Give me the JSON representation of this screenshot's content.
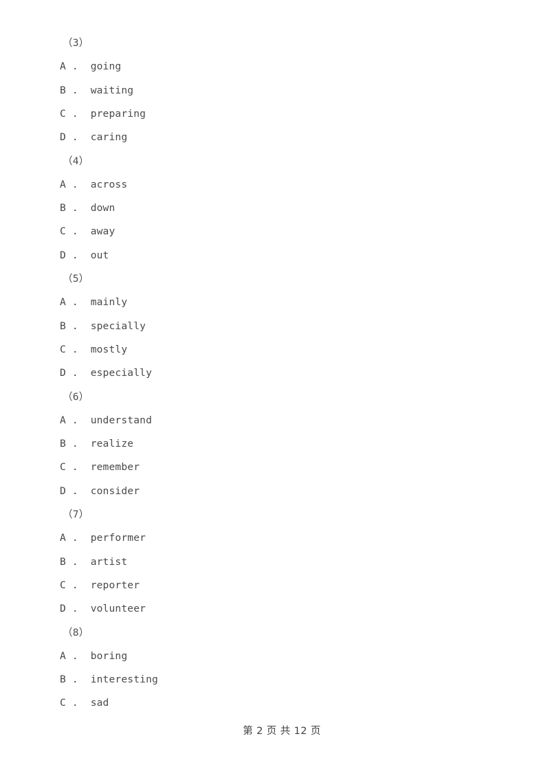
{
  "document": {
    "type": "exam-paper-page",
    "background_color": "#ffffff",
    "text_color": "#4a4a4a",
    "blocks": [
      {
        "number_label": "（3）",
        "options": [
          {
            "letter": "A",
            "separator": "．",
            "text": "going"
          },
          {
            "letter": "B",
            "separator": "．",
            "text": "waiting"
          },
          {
            "letter": "C",
            "separator": "．",
            "text": "preparing"
          },
          {
            "letter": "D",
            "separator": "．",
            "text": "caring"
          }
        ]
      },
      {
        "number_label": "（4）",
        "options": [
          {
            "letter": "A",
            "separator": "．",
            "text": "across"
          },
          {
            "letter": "B",
            "separator": "．",
            "text": "down"
          },
          {
            "letter": "C",
            "separator": "．",
            "text": "away"
          },
          {
            "letter": "D",
            "separator": "．",
            "text": "out"
          }
        ]
      },
      {
        "number_label": "（5）",
        "options": [
          {
            "letter": "A",
            "separator": "．",
            "text": "mainly"
          },
          {
            "letter": "B",
            "separator": "．",
            "text": "specially"
          },
          {
            "letter": "C",
            "separator": "．",
            "text": "mostly"
          },
          {
            "letter": "D",
            "separator": "．",
            "text": "especially"
          }
        ]
      },
      {
        "number_label": "（6）",
        "options": [
          {
            "letter": "A",
            "separator": "．",
            "text": "understand"
          },
          {
            "letter": "B",
            "separator": "．",
            "text": "realize"
          },
          {
            "letter": "C",
            "separator": "．",
            "text": "remember"
          },
          {
            "letter": "D",
            "separator": "．",
            "text": "consider"
          }
        ]
      },
      {
        "number_label": "（7）",
        "options": [
          {
            "letter": "A",
            "separator": "．",
            "text": "performer"
          },
          {
            "letter": "B",
            "separator": "．",
            "text": "artist"
          },
          {
            "letter": "C",
            "separator": "．",
            "text": "reporter"
          },
          {
            "letter": "D",
            "separator": "．",
            "text": "volunteer"
          }
        ]
      },
      {
        "number_label": "（8）",
        "options": [
          {
            "letter": "A",
            "separator": "．",
            "text": "boring"
          },
          {
            "letter": "B",
            "separator": "．",
            "text": "interesting"
          },
          {
            "letter": "C",
            "separator": "．",
            "text": "sad"
          }
        ]
      }
    ]
  },
  "footer": {
    "text": "第 2 页 共 12 页",
    "current_page": "2",
    "total_pages": "12"
  }
}
